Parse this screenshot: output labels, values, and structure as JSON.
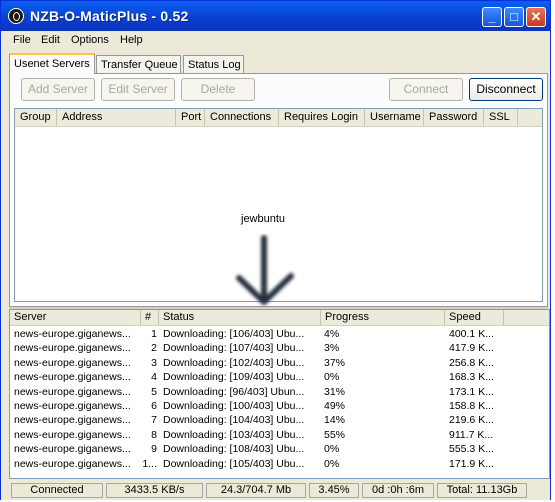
{
  "window": {
    "title": "NZB-O-MaticPlus - 0.52",
    "minimize": "_",
    "maximize": "□",
    "close": "✕"
  },
  "menu": [
    "File",
    "Edit",
    "Options",
    "Help"
  ],
  "tabs": [
    "Usenet Servers",
    "Transfer Queue",
    "Status Log"
  ],
  "toolbar": {
    "add": "Add Server",
    "edit": "Edit Server",
    "delete": "Delete",
    "connect": "Connect",
    "disconnect": "Disconnect"
  },
  "server_columns": [
    "Group",
    "Address",
    "Port",
    "Connections",
    "Requires Login",
    "Username",
    "Password",
    "SSL"
  ],
  "annotation": {
    "text": "jewbuntu"
  },
  "queue_columns": [
    "Server",
    "#",
    "Status",
    "Progress",
    "Speed"
  ],
  "queue_rows": [
    {
      "server": "news-europe.giganews...",
      "num": "1",
      "status": "Downloading: [106/403] Ubu...",
      "progress": "4%",
      "speed": "400.1 K..."
    },
    {
      "server": "news-europe.giganews...",
      "num": "2",
      "status": "Downloading: [107/403] Ubu...",
      "progress": "3%",
      "speed": "417.9 K..."
    },
    {
      "server": "news-europe.giganews...",
      "num": "3",
      "status": "Downloading: [102/403] Ubu...",
      "progress": "37%",
      "speed": "256.8 K..."
    },
    {
      "server": "news-europe.giganews...",
      "num": "4",
      "status": "Downloading: [109/403] Ubu...",
      "progress": "0%",
      "speed": "168.3 K..."
    },
    {
      "server": "news-europe.giganews...",
      "num": "5",
      "status": "Downloading: [96/403] Ubun...",
      "progress": "31%",
      "speed": "173.1 K..."
    },
    {
      "server": "news-europe.giganews...",
      "num": "6",
      "status": "Downloading: [100/403] Ubu...",
      "progress": "49%",
      "speed": "158.8 K..."
    },
    {
      "server": "news-europe.giganews...",
      "num": "7",
      "status": "Downloading: [104/403] Ubu...",
      "progress": "14%",
      "speed": "219.6 K..."
    },
    {
      "server": "news-europe.giganews...",
      "num": "8",
      "status": "Downloading: [103/403] Ubu...",
      "progress": "55%",
      "speed": "911.7 K..."
    },
    {
      "server": "news-europe.giganews...",
      "num": "9",
      "status": "Downloading: [108/403] Ubu...",
      "progress": "0%",
      "speed": "555.3 K..."
    },
    {
      "server": "news-europe.giganews...",
      "num": "1...",
      "status": "Downloading: [105/403] Ubu...",
      "progress": "0%",
      "speed": "171.9 K..."
    }
  ],
  "status": {
    "connection": "Connected",
    "speed": "3433.5 KB/s",
    "size": "24.3/704.7 Mb",
    "percent": "3.45%",
    "eta": "0d :0h :6m",
    "total": "Total: 11.13Gb"
  }
}
